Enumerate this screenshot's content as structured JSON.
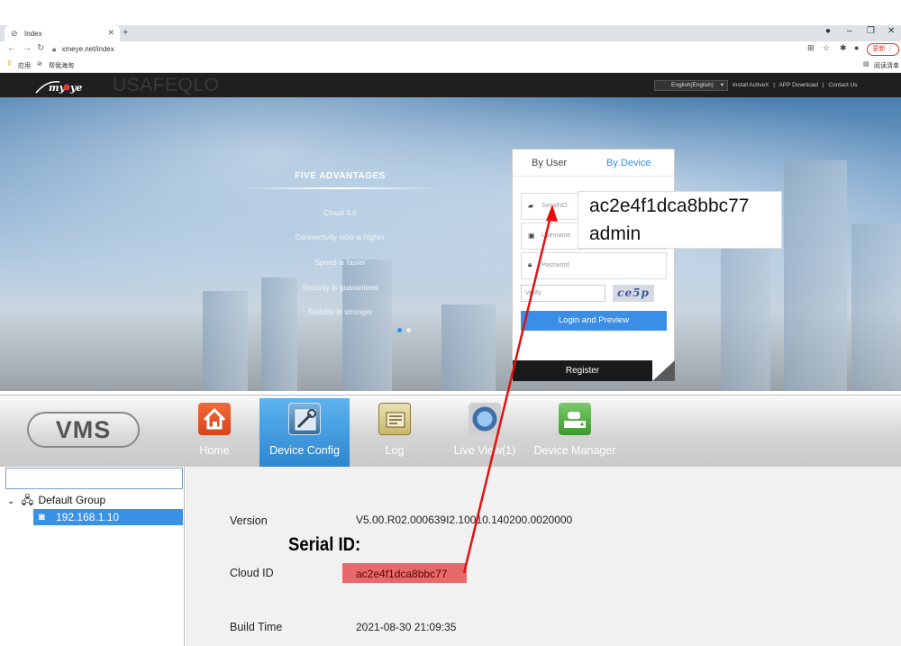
{
  "browser": {
    "tab_title": "Index",
    "url": "xmeye.net/index",
    "update_label": "更新",
    "bookmarks": [
      {
        "label": "应用"
      },
      {
        "label": "帮我海淘"
      }
    ],
    "reading_list_label": "阅读清单"
  },
  "site": {
    "watermark": "USAFEQLO",
    "language": "English(English)",
    "top_links": [
      "Install ActiveX",
      "APP Download",
      "Contact Us"
    ],
    "advantages_title": "FIVE ADVANTAGES",
    "advantages": [
      "Cloud 3.0",
      "Connectivity ratio is higher",
      "Speed is faster",
      "Security is guaranteed",
      "Stability is stronger"
    ]
  },
  "login": {
    "tab_by_user": "By User",
    "tab_by_device": "By Device",
    "serial_placeholder": "SerialNO.",
    "username_placeholder": "Username",
    "password_placeholder": "Password",
    "verify_placeholder": "Verify",
    "captcha": "ce5p",
    "login_button": "Login and Preview",
    "register_button": "Register",
    "annotation_serial": "ac2e4f1dca8bbc77",
    "annotation_user": "admin"
  },
  "vms": {
    "logo": "VMS",
    "nav": [
      "Home",
      "Device Config",
      "Log",
      "Live View(1)",
      "Device Manager"
    ],
    "tree_group": "Default Group",
    "tree_device": "192.168.1.10",
    "version_label": "Version",
    "version_value": "V5.00.R02.000639I2.10010.140200.0020000",
    "serial_annotation": "Serial ID:",
    "cloud_label": "Cloud ID",
    "cloud_value": "ac2e4f1dca8bbc77",
    "build_label": "Build Time",
    "build_value": "2021-08-30 21:09:35"
  },
  "colors": {
    "accent_blue": "#3a8ee6",
    "highlight_red": "#e76a6a",
    "arrow_red": "#e31010"
  }
}
